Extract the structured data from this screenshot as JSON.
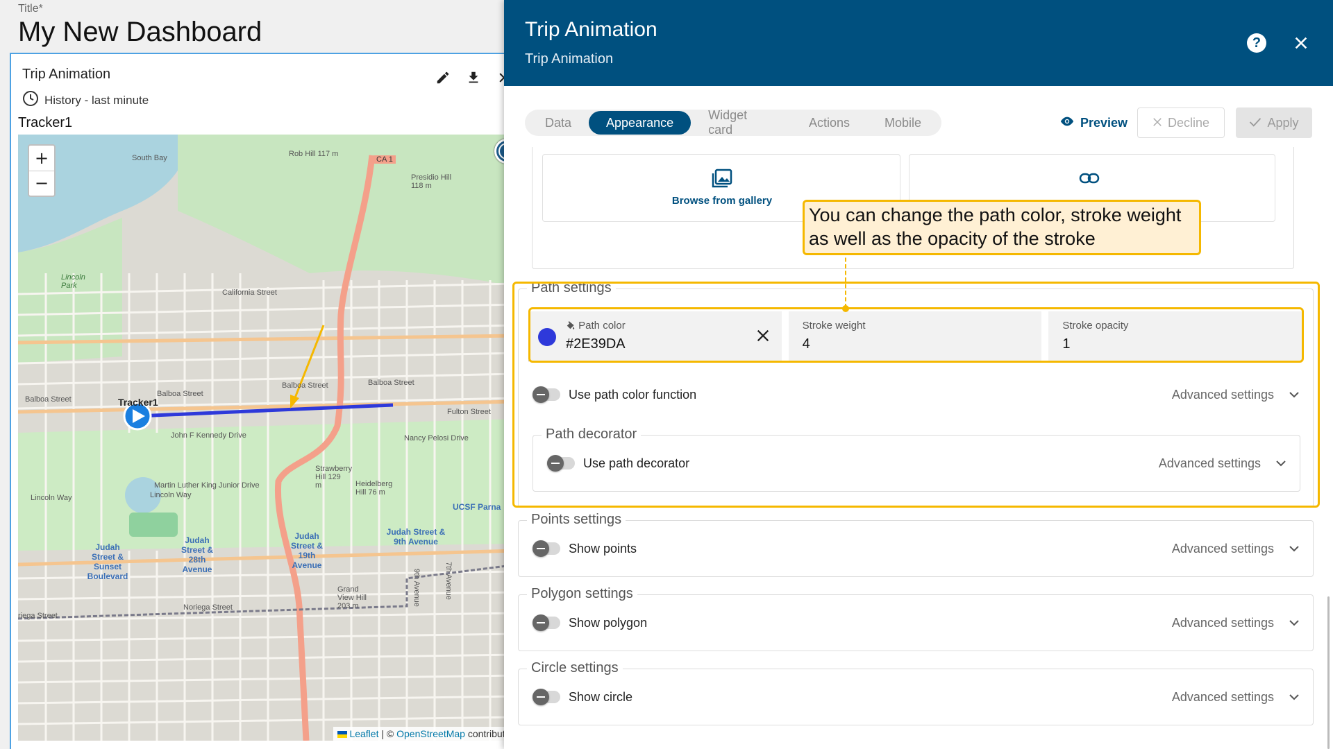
{
  "dashboard": {
    "title_label": "Title*",
    "title": "My New Dashboard"
  },
  "widget": {
    "title": "Trip Animation",
    "history": "History - last minute",
    "tracker_title": "Tracker1",
    "tools": [
      "pencil-icon",
      "download-icon",
      "close-icon"
    ]
  },
  "map": {
    "zoom_in": "+",
    "zoom_out": "−",
    "attribution": {
      "leaflet": "Leaflet",
      "separator": " | © ",
      "osm": "OpenStreetMap",
      "suffix": " contributor"
    },
    "labels": {
      "south_bay": "South Bay",
      "rob_hill": "Rob Hill 117 m",
      "ca1": "CA 1",
      "presidio_hill": "Presidio Hill 118 m",
      "lincoln_park": "Lincoln Park",
      "california_street": "California Street",
      "balboa_street_1": "Balboa Street",
      "balboa_street_2": "Balboa Street",
      "balboa_street_3": "Balboa Street",
      "balboa_street_4": "Balboa Street",
      "tracker_marker": "Tracker1",
      "fulton_street": "Fulton Street",
      "jfk_drive": "John F Kennedy Drive",
      "mlk_drive": "Martin Luther King Junior Drive",
      "strawberry_hill": "Strawberry Hill 129 m",
      "heidelberg_hill": "Heidelberg Hill 76 m",
      "nancy_pelosi": "Nancy Pelosi Drive",
      "lincoln_way_1": "Lincoln Way",
      "lincoln_way_2": "Lincoln Way",
      "ucsf": "UCSF Parna",
      "judah_sunset": "Judah Street & Sunset Boulevard",
      "judah_28th": "Judah Street & 28th Avenue",
      "judah_19th": "Judah Street & 19th Avenue",
      "judah_9th": "Judah Street & 9th Avenue",
      "grand_view": "Grand View Hill 203 m",
      "noriega_street": "Noriega Street",
      "noriega_street_2": "riega Street",
      "ninth_avenue": "9th Avenue",
      "seventh_avenue": "7th Avenue"
    }
  },
  "panel": {
    "title": "Trip Animation",
    "subtitle": "Trip Animation",
    "help_glyph": "?",
    "tabs": [
      {
        "label": "Data",
        "active": false
      },
      {
        "label": "Appearance",
        "active": true
      },
      {
        "label": "Widget card",
        "active": false
      },
      {
        "label": "Actions",
        "active": false
      },
      {
        "label": "Mobile",
        "active": false
      }
    ],
    "preview_label": "Preview",
    "decline_label": "Decline",
    "apply_label": "Apply",
    "image": {
      "gallery_label": "Browse from gallery"
    },
    "path_settings": {
      "legend": "Path settings",
      "path_color_label": "Path color",
      "path_color_value": "#2E39DA",
      "stroke_weight_label": "Stroke weight",
      "stroke_weight_value": "4",
      "stroke_opacity_label": "Stroke opacity",
      "stroke_opacity_value": "1",
      "use_color_function": "Use path color function",
      "advanced": "Advanced settings",
      "decorator": {
        "legend": "Path decorator",
        "use_decorator": "Use path decorator",
        "advanced": "Advanced settings"
      }
    },
    "points_settings": {
      "legend": "Points settings",
      "toggle_label": "Show points",
      "advanced": "Advanced settings"
    },
    "polygon_settings": {
      "legend": "Polygon settings",
      "toggle_label": "Show polygon",
      "advanced": "Advanced settings"
    },
    "circle_settings": {
      "legend": "Circle settings",
      "toggle_label": "Show circle",
      "advanced": "Advanced settings"
    }
  },
  "tooltip": {
    "line1": "You can change the path color, stroke weight",
    "line2": "as well as the opacity of the stroke"
  },
  "colors": {
    "header": "#00507f",
    "path": "#2E39DA",
    "highlight": "#f5b800"
  }
}
